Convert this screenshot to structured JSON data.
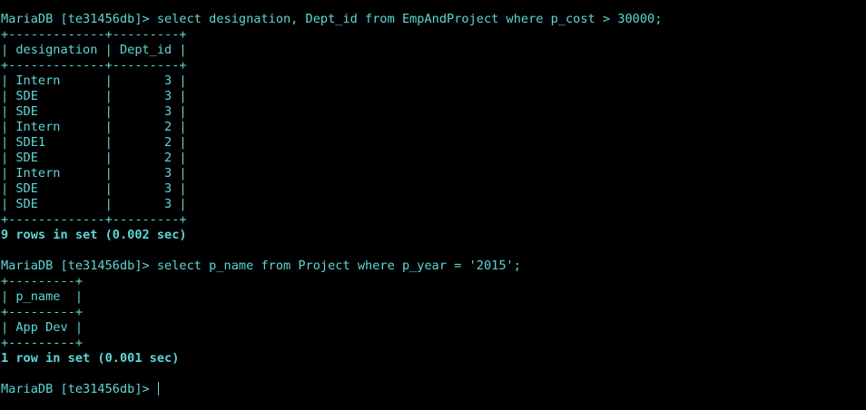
{
  "colors": {
    "background": "#000000",
    "text": "#5fd7d7"
  },
  "lines": [
    {
      "text": "MariaDB [te31456db]> select designation, Dept_id from EmpAndProject where p_cost > 30000;",
      "bold": false
    },
    {
      "text": "+-------------+---------+",
      "bold": false
    },
    {
      "text": "| designation | Dept_id |",
      "bold": false
    },
    {
      "text": "+-------------+---------+",
      "bold": false
    },
    {
      "text": "| Intern      |       3 |",
      "bold": false
    },
    {
      "text": "| SDE         |       3 |",
      "bold": false
    },
    {
      "text": "| SDE         |       3 |",
      "bold": false
    },
    {
      "text": "| Intern      |       2 |",
      "bold": false
    },
    {
      "text": "| SDE1        |       2 |",
      "bold": false
    },
    {
      "text": "| SDE         |       2 |",
      "bold": false
    },
    {
      "text": "| Intern      |       3 |",
      "bold": false
    },
    {
      "text": "| SDE         |       3 |",
      "bold": false
    },
    {
      "text": "| SDE         |       3 |",
      "bold": false
    },
    {
      "text": "+-------------+---------+",
      "bold": false
    },
    {
      "text": "9 rows in set (0.002 sec)",
      "bold": true
    },
    {
      "text": "",
      "bold": false
    },
    {
      "text": "MariaDB [te31456db]> select p_name from Project where p_year = '2015';",
      "bold": false
    },
    {
      "text": "+---------+",
      "bold": false
    },
    {
      "text": "| p_name  |",
      "bold": false
    },
    {
      "text": "+---------+",
      "bold": false
    },
    {
      "text": "| App Dev |",
      "bold": false
    },
    {
      "text": "+---------+",
      "bold": false
    },
    {
      "text": "1 row in set (0.001 sec)",
      "bold": true
    },
    {
      "text": "",
      "bold": false
    },
    {
      "text": "MariaDB [te31456db]> ",
      "bold": false,
      "cursor": true
    }
  ]
}
